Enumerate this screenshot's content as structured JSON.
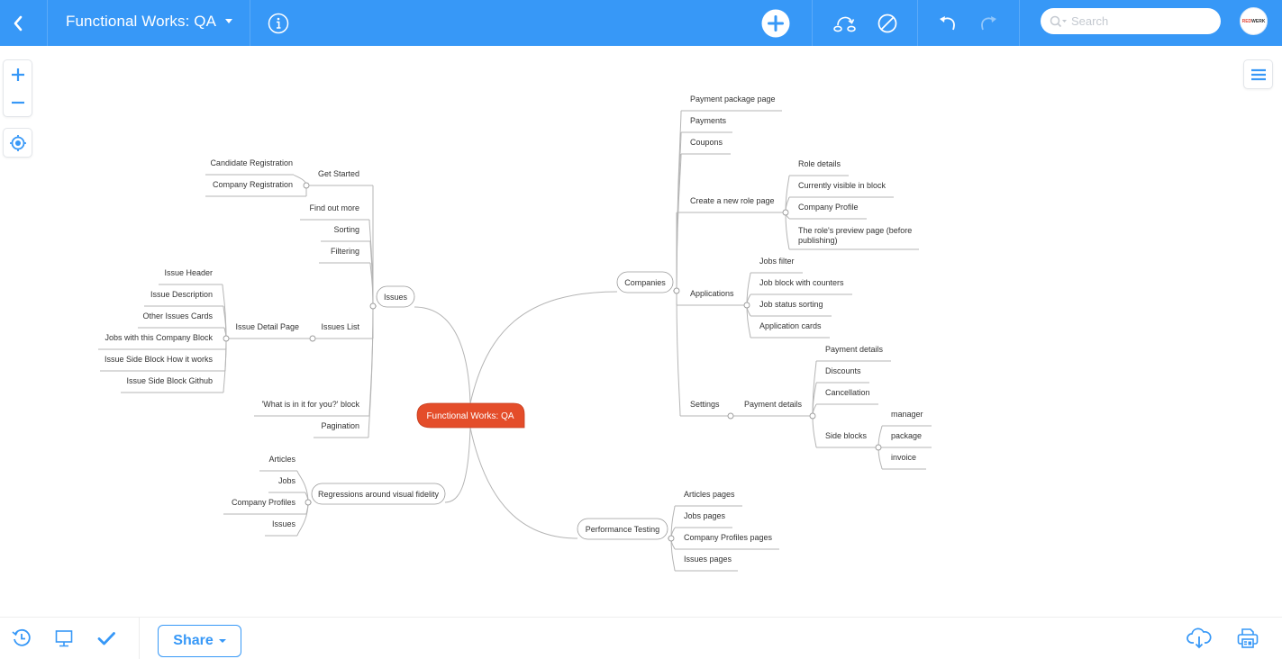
{
  "topbar": {
    "back_icon": "chevron-left-icon",
    "title": "Functional Works: QA",
    "info_icon": "info-icon",
    "add_icon": "plus-circle-icon",
    "relationship_icon": "relationship-icon",
    "boundary_icon": "no-entry-icon",
    "undo_icon": "undo-icon",
    "redo_icon": "redo-icon",
    "search_placeholder": "Search",
    "avatar_text_red": "RED",
    "avatar_text_dark": "WERK"
  },
  "left_controls": {
    "zoom_in_icon": "plus-icon",
    "zoom_out_icon": "minus-icon",
    "center_icon": "target-icon"
  },
  "right_controls": {
    "outline_icon": "menu-icon"
  },
  "bottombar": {
    "history_icon": "history-icon",
    "present_icon": "presentation-icon",
    "task_icon": "checkmark-icon",
    "share_label": "Share",
    "download_icon": "cloud-download-icon",
    "print_icon": "printer-icon"
  },
  "colors": {
    "accent": "#3798f7",
    "root_fill": "#e44d2a",
    "line": "#b5b5b5",
    "text": "#333333"
  },
  "mindmap": {
    "root": "Functional Works: QA",
    "nodes": [
      {
        "id": "issues",
        "label": "Issues",
        "parent": "root",
        "style": "pill"
      },
      {
        "id": "getstarted",
        "label": "Get Started",
        "parent": "issues"
      },
      {
        "id": "candreg",
        "label": "Candidate Registration",
        "parent": "getstarted"
      },
      {
        "id": "compreg",
        "label": "Company Registration",
        "parent": "getstarted"
      },
      {
        "id": "findout",
        "label": "Find out more",
        "parent": "issues"
      },
      {
        "id": "sorting",
        "label": "Sorting",
        "parent": "issues"
      },
      {
        "id": "filtering",
        "label": "Filtering",
        "parent": "issues"
      },
      {
        "id": "issueslist",
        "label": "Issues List",
        "parent": "issues"
      },
      {
        "id": "issuedetail",
        "label": "Issue Detail Page",
        "parent": "issueslist"
      },
      {
        "id": "ih",
        "label": "Issue Header",
        "parent": "issuedetail"
      },
      {
        "id": "idesc",
        "label": "Issue Description",
        "parent": "issuedetail"
      },
      {
        "id": "oic",
        "label": "Other Issues Cards",
        "parent": "issuedetail"
      },
      {
        "id": "jwc",
        "label": "Jobs with this Company Block",
        "parent": "issuedetail"
      },
      {
        "id": "isbh",
        "label": "Issue Side Block How it works",
        "parent": "issuedetail"
      },
      {
        "id": "isbg",
        "label": "Issue Side Block Github",
        "parent": "issuedetail"
      },
      {
        "id": "whatis",
        "label": "'What is in it for you?' block",
        "parent": "issues"
      },
      {
        "id": "pagination",
        "label": "Pagination",
        "parent": "issues"
      },
      {
        "id": "regress",
        "label": "Regressions around visual fidelity",
        "parent": "root",
        "style": "pill"
      },
      {
        "id": "r_articles",
        "label": "Articles",
        "parent": "regress"
      },
      {
        "id": "r_jobs",
        "label": "Jobs",
        "parent": "regress"
      },
      {
        "id": "r_cp",
        "label": "Company Profiles",
        "parent": "regress"
      },
      {
        "id": "r_issues",
        "label": "Issues",
        "parent": "regress"
      },
      {
        "id": "companies",
        "label": "Companies",
        "parent": "root",
        "style": "pill"
      },
      {
        "id": "ppp",
        "label": "Payment package page",
        "parent": "companies"
      },
      {
        "id": "payments",
        "label": "Payments",
        "parent": "companies"
      },
      {
        "id": "coupons",
        "label": "Coupons",
        "parent": "companies"
      },
      {
        "id": "cnrp",
        "label": "Create a new role page",
        "parent": "companies"
      },
      {
        "id": "roled",
        "label": "Role details",
        "parent": "cnrp"
      },
      {
        "id": "cvib",
        "label": "Currently visible in block",
        "parent": "cnrp"
      },
      {
        "id": "compprof",
        "label": "Company Profile",
        "parent": "cnrp"
      },
      {
        "id": "preview",
        "label": "The role's preview page (before publishing)",
        "parent": "cnrp"
      },
      {
        "id": "apps",
        "label": "Applications",
        "parent": "companies"
      },
      {
        "id": "jf",
        "label": "Jobs filter",
        "parent": "apps"
      },
      {
        "id": "jbwc",
        "label": "Job block with counters",
        "parent": "apps"
      },
      {
        "id": "jss",
        "label": "Job status sorting",
        "parent": "apps"
      },
      {
        "id": "ac",
        "label": "Application cards",
        "parent": "apps"
      },
      {
        "id": "settings",
        "label": "Settings",
        "parent": "companies"
      },
      {
        "id": "paydet",
        "label": "Payment details",
        "parent": "settings"
      },
      {
        "id": "paydet2",
        "label": "Payment details",
        "parent": "paydet"
      },
      {
        "id": "discounts",
        "label": "Discounts",
        "parent": "paydet"
      },
      {
        "id": "cancel",
        "label": "Cancellation",
        "parent": "paydet"
      },
      {
        "id": "sideblocks",
        "label": "Side blocks",
        "parent": "paydet"
      },
      {
        "id": "manager",
        "label": "manager",
        "parent": "sideblocks"
      },
      {
        "id": "package",
        "label": "package",
        "parent": "sideblocks"
      },
      {
        "id": "invoice",
        "label": "invoice",
        "parent": "sideblocks"
      },
      {
        "id": "perf",
        "label": "Performance Testing",
        "parent": "root",
        "style": "pill"
      },
      {
        "id": "ap",
        "label": "Articles pages",
        "parent": "perf"
      },
      {
        "id": "jp",
        "label": "Jobs pages",
        "parent": "perf"
      },
      {
        "id": "cpp",
        "label": "Company Profiles pages",
        "parent": "perf"
      },
      {
        "id": "ipg",
        "label": "Issues pages",
        "parent": "perf"
      }
    ]
  }
}
